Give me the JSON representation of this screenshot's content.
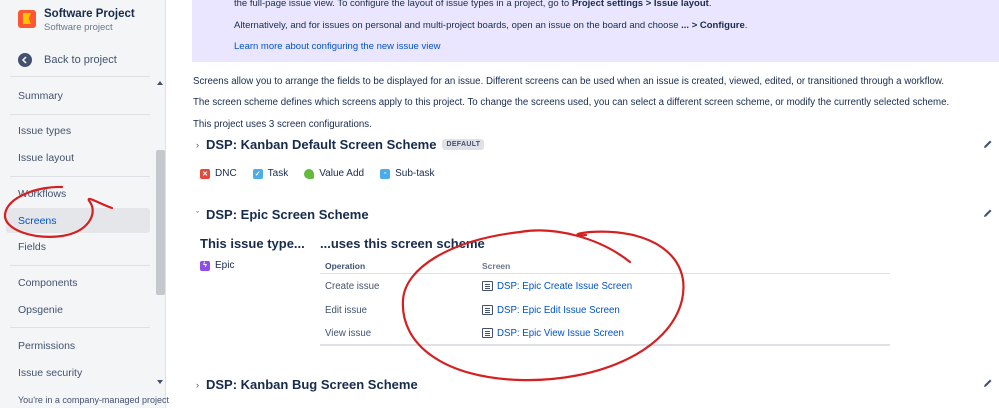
{
  "sidebar": {
    "project_name": "Software Project",
    "project_type": "Software project",
    "back_label": "Back to project",
    "items": [
      {
        "label": "Summary"
      },
      {
        "label": "Issue types"
      },
      {
        "label": "Issue layout"
      },
      {
        "label": "Workflows"
      },
      {
        "label": "Screens"
      },
      {
        "label": "Fields"
      },
      {
        "label": "Components"
      },
      {
        "label": "Opsgenie"
      },
      {
        "label": "Permissions"
      },
      {
        "label": "Issue security"
      }
    ],
    "active_item": "Screens",
    "footer_note": "You're in a company-managed project"
  },
  "banner": {
    "line1_a": "the full-page issue view. To configure the layout of issue types in a project, go to ",
    "line1_b": "Project settings > Issue layout",
    "line1_c": ".",
    "line2_a": "Alternatively, and for issues on personal and multi-project boards, open an issue on the board and choose ",
    "line2_b": "... > Configure",
    "line2_c": ".",
    "link": "Learn more about configuring the new issue view"
  },
  "intro": {
    "p1": "Screens allow you to arrange the fields to be displayed for an issue. Different screens can be used when an issue is created, viewed, edited, or transitioned through a workflow.",
    "p2": "The screen scheme defines which screens apply to this project. To change the screens used, you can select a different screen scheme, or modify the currently selected scheme.",
    "p3": "This project uses 3 screen configurations."
  },
  "schemes": [
    {
      "name": "DSP: Kanban Default Screen Scheme",
      "badge": "DEFAULT",
      "expanded": false,
      "issue_types": [
        {
          "label": "DNC",
          "color": "#e5493a"
        },
        {
          "label": "Task",
          "color": "#4bade8"
        },
        {
          "label": "Value Add",
          "color": "#63ba3c"
        },
        {
          "label": "Sub-task",
          "color": "#4bade8"
        }
      ]
    },
    {
      "name": "DSP: Epic Screen Scheme",
      "expanded": true,
      "col_left_heading": "This issue type...",
      "col_right_heading": "...uses this screen scheme",
      "issue_type": {
        "label": "Epic",
        "color": "#904ee2"
      },
      "table": {
        "headers": [
          "Operation",
          "Screen"
        ],
        "rows": [
          {
            "operation": "Create issue",
            "screen": "DSP: Epic Create Issue Screen"
          },
          {
            "operation": "Edit issue",
            "screen": "DSP: Epic Edit Issue Screen"
          },
          {
            "operation": "View issue",
            "screen": "DSP: Epic View Issue Screen"
          }
        ]
      }
    },
    {
      "name": "DSP: Kanban Bug Screen Scheme",
      "expanded": false
    }
  ],
  "colors": {
    "annotation": "#d42020",
    "link": "#0052cc",
    "banner": "#eae6ff"
  }
}
